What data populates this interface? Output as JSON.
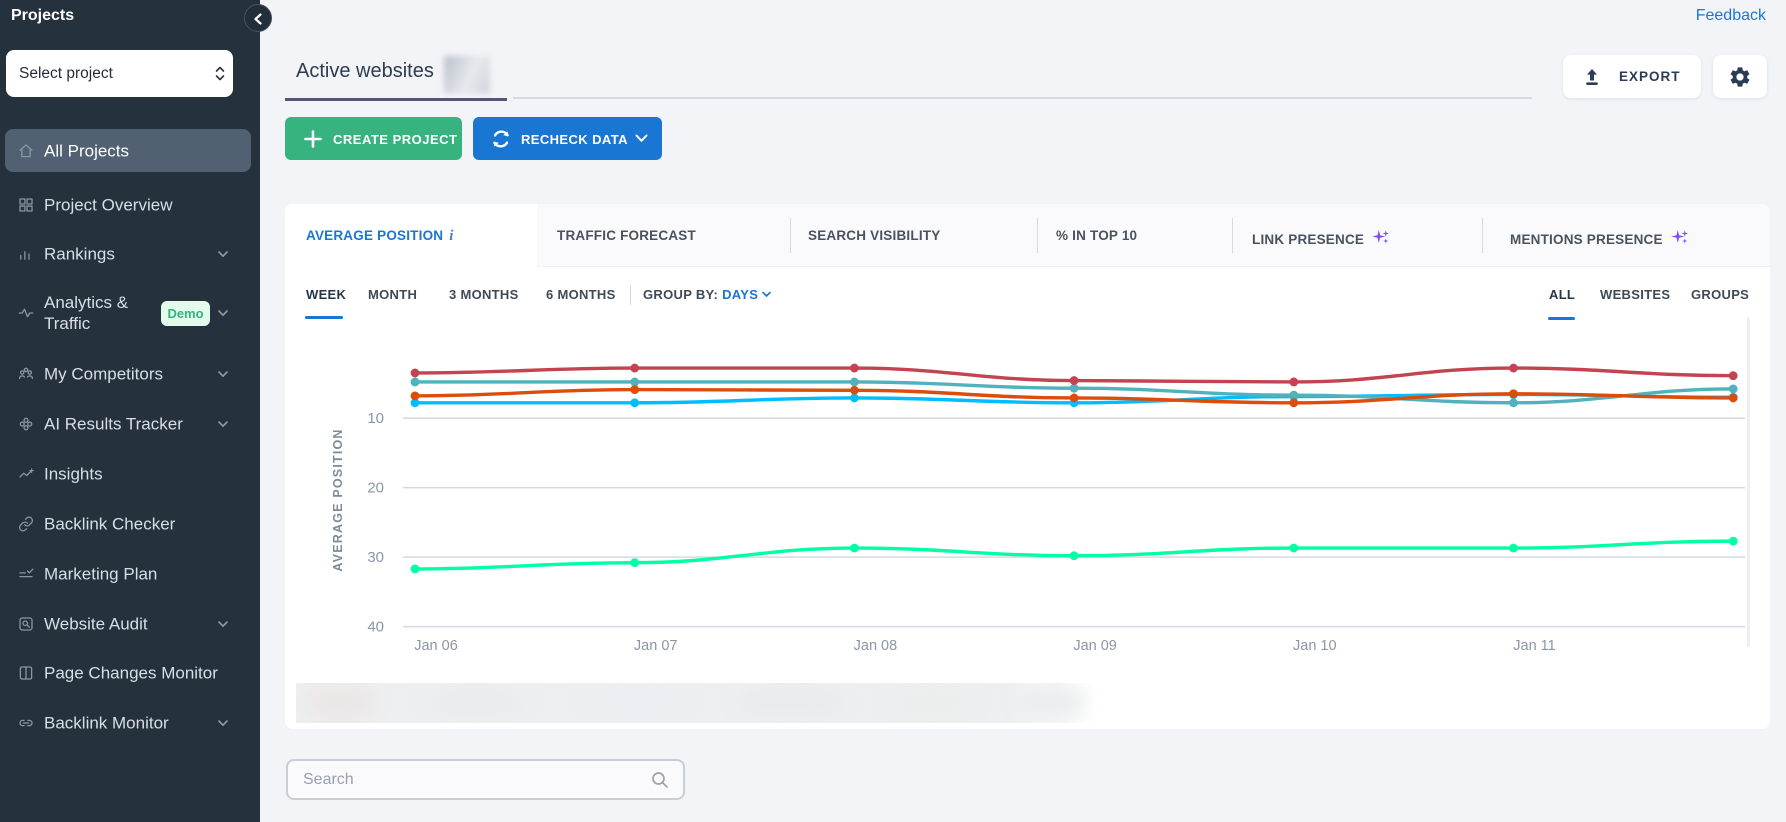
{
  "sidebar": {
    "title": "Projects",
    "select_label": "Select project",
    "items": [
      {
        "label": "All Projects",
        "icon": "home-icon",
        "active": true
      },
      {
        "label": "Project Overview",
        "icon": "grid-icon"
      },
      {
        "label": "Rankings",
        "icon": "bar-chart-icon",
        "chevron": true
      },
      {
        "label": "Analytics & Traffic",
        "icon": "activity-icon",
        "chevron": true,
        "badge": "Demo",
        "two_line": true
      },
      {
        "label": "My Competitors",
        "icon": "people-icon",
        "chevron": true
      },
      {
        "label": "AI Results Tracker",
        "icon": "ai-icon",
        "chevron": true
      },
      {
        "label": "Insights",
        "icon": "insights-icon"
      },
      {
        "label": "Backlink Checker",
        "icon": "link-icon"
      },
      {
        "label": "Marketing Plan",
        "icon": "checklist-icon"
      },
      {
        "label": "Website Audit",
        "icon": "audit-icon",
        "chevron": true
      },
      {
        "label": "Page Changes Monitor",
        "icon": "pages-icon"
      },
      {
        "label": "Backlink Monitor",
        "icon": "link-monitor-icon",
        "chevron": true
      }
    ]
  },
  "header": {
    "feedback": "Feedback",
    "page_tab": "Active websites",
    "export_label": "EXPORT"
  },
  "actions": {
    "create_project": "CREATE PROJECT",
    "recheck_data": "RECHECK DATA"
  },
  "tabs": [
    {
      "label": "AVERAGE POSITION",
      "active": true,
      "info": "i"
    },
    {
      "label": "TRAFFIC FORECAST"
    },
    {
      "label": "SEARCH VISIBILITY"
    },
    {
      "label": "% IN TOP 10"
    },
    {
      "label": "LINK PRESENCE",
      "sparkle": true
    },
    {
      "label": "MENTIONS PRESENCE",
      "sparkle": true
    }
  ],
  "filters": {
    "ranges": [
      "WEEK",
      "MONTH",
      "3 MONTHS",
      "6 MONTHS"
    ],
    "active_range": "WEEK",
    "group_by_label": "GROUP BY:",
    "group_by_value": "DAYS",
    "scopes": [
      "ALL",
      "WEBSITES",
      "GROUPS"
    ],
    "active_scope": "ALL"
  },
  "search": {
    "placeholder": "Search"
  },
  "chart_data": {
    "type": "line",
    "title": "",
    "ylabel": "AVERAGE POSITION",
    "y_inverted": true,
    "yticks": [
      10,
      20,
      30,
      40
    ],
    "grid": true,
    "x_labels": [
      "Jan 06",
      "Jan 07",
      "Jan 08",
      "Jan 09",
      "Jan 10",
      "Jan 11",
      ""
    ],
    "series": [
      {
        "name": "green",
        "color": "#01ffa4",
        "values": [
          31.7,
          30.8,
          28.7,
          29.8,
          28.7,
          28.7,
          27.7
        ]
      },
      {
        "name": "cyan",
        "color": "#00bdff",
        "values": [
          7.8,
          7.8,
          7.1,
          7.8,
          6.9,
          6.6,
          7.0
        ]
      },
      {
        "name": "teal",
        "color": "#51b1bc",
        "values": [
          4.8,
          4.8,
          4.8,
          5.7,
          6.7,
          7.8,
          5.8
        ]
      },
      {
        "name": "orange",
        "color": "#dc4c0a",
        "values": [
          6.8,
          5.9,
          6.0,
          7.1,
          7.8,
          6.5,
          7.1
        ]
      },
      {
        "name": "red",
        "color": "#c44350",
        "values": [
          3.5,
          2.8,
          2.8,
          4.6,
          4.8,
          2.8,
          3.9
        ]
      }
    ]
  }
}
